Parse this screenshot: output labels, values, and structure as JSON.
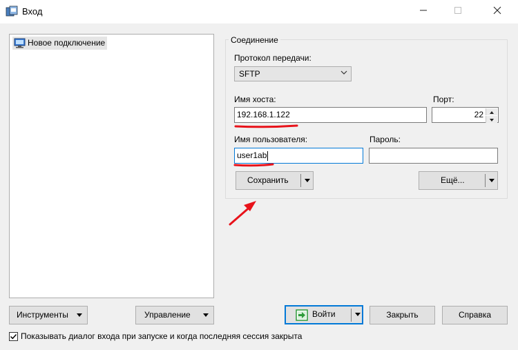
{
  "window": {
    "title": "Вход"
  },
  "sessions": {
    "items": [
      {
        "label": "Новое подключение"
      }
    ]
  },
  "connection": {
    "group_label": "Соединение",
    "protocol_label": "Протокол передачи:",
    "protocol_value": "SFTP",
    "host_label": "Имя хоста:",
    "host_value": "192.168.1.122",
    "port_label": "Порт:",
    "port_value": "22",
    "user_label": "Имя пользователя:",
    "user_value": "user1ab",
    "password_label": "Пароль:",
    "password_value": "",
    "save_label": "Сохранить",
    "more_label": "Ещё..."
  },
  "bottom": {
    "tools_label": "Инструменты",
    "manage_label": "Управление",
    "login_label": "Войти",
    "close_label": "Закрыть",
    "help_label": "Справка",
    "show_dialog_label": "Показывать диалог входа при запуске и когда последняя сессия закрыта",
    "show_dialog_checked": true
  },
  "annotations": {
    "underline_color": "#e8121a",
    "arrow_color": "#e8121a"
  },
  "colors": {
    "focus_border": "#0078d7",
    "login_icon_green": "#2e9b3a"
  }
}
